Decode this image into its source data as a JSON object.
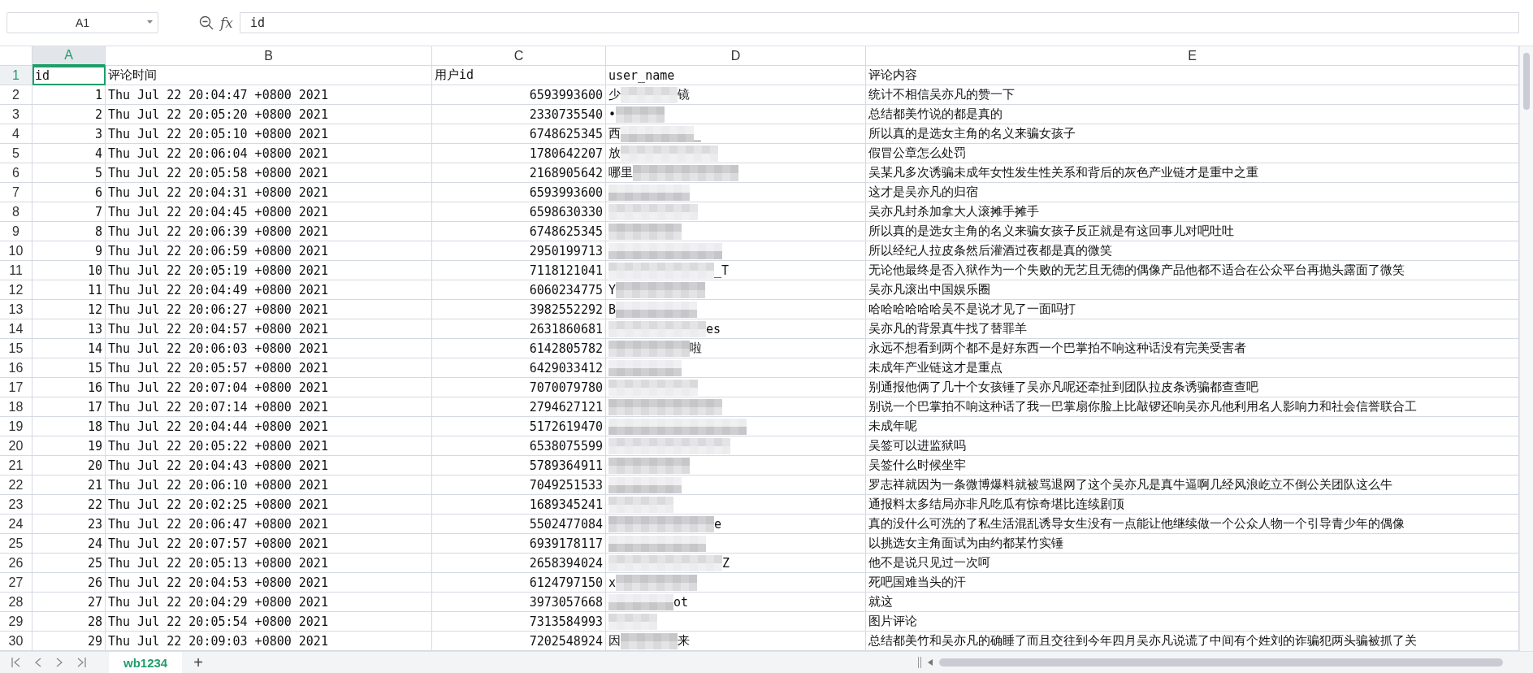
{
  "name_box": "A1",
  "formula_bar": {
    "function_label": "fx",
    "value": "id"
  },
  "columns": [
    {
      "label": "A",
      "selected": true
    },
    {
      "label": "B",
      "selected": false
    },
    {
      "label": "C",
      "selected": false
    },
    {
      "label": "D",
      "selected": false
    },
    {
      "label": "E",
      "selected": false
    }
  ],
  "header_row": {
    "number": "1",
    "selected": true,
    "cells": [
      "id",
      "评论时间",
      "用户id",
      "user_name",
      "评论内容"
    ]
  },
  "rows": [
    {
      "number": "2",
      "selected": false,
      "id": "1",
      "time": "Thu Jul 22 20:04:47 +0800 2021",
      "user_id": "6593993600",
      "user_name": {
        "start": "少",
        "end": "镜"
      },
      "comment": "统计不相信吴亦凡的赞一下"
    },
    {
      "number": "3",
      "selected": false,
      "id": "2",
      "time": "Thu Jul 22 20:05:20 +0800 2021",
      "user_id": "2330735540",
      "user_name": {
        "start": "•"
      },
      "comment": "总结都美竹说的都是真的"
    },
    {
      "number": "4",
      "selected": false,
      "id": "3",
      "time": "Thu Jul 22 20:05:10 +0800 2021",
      "user_id": "6748625345",
      "user_name": {
        "start": "西",
        "end": "_"
      },
      "comment": "所以真的是选女主角的名义来骗女孩子"
    },
    {
      "number": "5",
      "selected": false,
      "id": "4",
      "time": "Thu Jul 22 20:06:04 +0800 2021",
      "user_id": "1780642207",
      "user_name": {
        "start": "放"
      },
      "comment": "假冒公章怎么处罚"
    },
    {
      "number": "6",
      "selected": false,
      "id": "5",
      "time": "Thu Jul 22 20:05:58 +0800 2021",
      "user_id": "2168905642",
      "user_name": {
        "start": "哪里"
      },
      "comment": "吴某凡多次诱骗未成年女性发生性关系和背后的灰色产业链才是重中之重"
    },
    {
      "number": "7",
      "selected": false,
      "id": "6",
      "time": "Thu Jul 22 20:04:31 +0800 2021",
      "user_id": "6593993600",
      "user_name": {},
      "comment": "这才是吴亦凡的归宿"
    },
    {
      "number": "8",
      "selected": false,
      "id": "7",
      "time": "Thu Jul 22 20:04:45 +0800 2021",
      "user_id": "6598630330",
      "user_name": {},
      "comment": "吴亦凡封杀加拿大人滚摊手摊手"
    },
    {
      "number": "9",
      "selected": false,
      "id": "8",
      "time": "Thu Jul 22 20:06:39 +0800 2021",
      "user_id": "6748625345",
      "user_name": {},
      "comment": "所以真的是选女主角的名义来骗女孩子反正就是有这回事儿对吧吐吐"
    },
    {
      "number": "10",
      "selected": false,
      "id": "9",
      "time": "Thu Jul 22 20:06:59 +0800 2021",
      "user_id": "2950199713",
      "user_name": {},
      "comment": "所以经纪人拉皮条然后灌酒过夜都是真的微笑"
    },
    {
      "number": "11",
      "selected": false,
      "id": "10",
      "time": "Thu Jul 22 20:05:19 +0800 2021",
      "user_id": "7118121041",
      "user_name": {
        "end": "_T"
      },
      "comment": "无论他最终是否入狱作为一个失败的无艺且无德的偶像产品他都不适合在公众平台再抛头露面了微笑"
    },
    {
      "number": "12",
      "selected": false,
      "id": "11",
      "time": "Thu Jul 22 20:04:49 +0800 2021",
      "user_id": "6060234775",
      "user_name": {
        "start": "Y"
      },
      "comment": "吴亦凡滚出中国娱乐圈"
    },
    {
      "number": "13",
      "selected": false,
      "id": "12",
      "time": "Thu Jul 22 20:06:27 +0800 2021",
      "user_id": "3982552292",
      "user_name": {
        "start": "B"
      },
      "comment": "哈哈哈哈哈哈吴不是说才见了一面吗打"
    },
    {
      "number": "14",
      "selected": false,
      "id": "13",
      "time": "Thu Jul 22 20:04:57 +0800 2021",
      "user_id": "2631860681",
      "user_name": {
        "end": "es"
      },
      "comment": "吴亦凡的背景真牛找了替罪羊"
    },
    {
      "number": "15",
      "selected": false,
      "id": "14",
      "time": "Thu Jul 22 20:06:03 +0800 2021",
      "user_id": "6142805782",
      "user_name": {
        "end": "啦"
      },
      "comment": "永远不想看到两个都不是好东西一个巴掌拍不响这种话没有完美受害者"
    },
    {
      "number": "16",
      "selected": false,
      "id": "15",
      "time": "Thu Jul 22 20:05:57 +0800 2021",
      "user_id": "6429033412",
      "user_name": {},
      "comment": "未成年产业链这才是重点"
    },
    {
      "number": "17",
      "selected": false,
      "id": "16",
      "time": "Thu Jul 22 20:07:04 +0800 2021",
      "user_id": "7070079780",
      "user_name": {},
      "comment": "别通报他俩了几十个女孩锤了吴亦凡呢还牵扯到团队拉皮条诱骗都查查吧"
    },
    {
      "number": "18",
      "selected": false,
      "id": "17",
      "time": "Thu Jul 22 20:07:14 +0800 2021",
      "user_id": "2794627121",
      "user_name": {},
      "comment": "别说一个巴掌拍不响这种话了我一巴掌扇你脸上比敲锣还响吴亦凡他利用名人影响力和社会信誉联合工"
    },
    {
      "number": "19",
      "selected": false,
      "id": "18",
      "time": "Thu Jul 22 20:04:44 +0800 2021",
      "user_id": "5172619470",
      "user_name": {},
      "comment": "未成年呢"
    },
    {
      "number": "20",
      "selected": false,
      "id": "19",
      "time": "Thu Jul 22 20:05:22 +0800 2021",
      "user_id": "6538075599",
      "user_name": {},
      "comment": "吴签可以进监狱吗"
    },
    {
      "number": "21",
      "selected": false,
      "id": "20",
      "time": "Thu Jul 22 20:04:43 +0800 2021",
      "user_id": "5789364911",
      "user_name": {},
      "comment": "吴签什么时候坐牢"
    },
    {
      "number": "22",
      "selected": false,
      "id": "21",
      "time": "Thu Jul 22 20:06:10 +0800 2021",
      "user_id": "7049251533",
      "user_name": {},
      "comment": "罗志祥就因为一条微博爆料就被骂退网了这个吴亦凡是真牛逼啊几经风浪屹立不倒公关团队这么牛"
    },
    {
      "number": "23",
      "selected": false,
      "id": "22",
      "time": "Thu Jul 22 20:02:25 +0800 2021",
      "user_id": "1689345241",
      "user_name": {},
      "comment": "通报料太多结局亦非凡吃瓜有惊奇堪比连续剧顶"
    },
    {
      "number": "24",
      "selected": false,
      "id": "23",
      "time": "Thu Jul 22 20:06:47 +0800 2021",
      "user_id": "5502477084",
      "user_name": {
        "end": "e"
      },
      "comment": "真的没什么可洗的了私生活混乱诱导女生没有一点能让他继续做一个公众人物一个引导青少年的偶像"
    },
    {
      "number": "25",
      "selected": false,
      "id": "24",
      "time": "Thu Jul 22 20:07:57 +0800 2021",
      "user_id": "6939178117",
      "user_name": {},
      "comment": "以挑选女主角面试为由约都某竹实锤"
    },
    {
      "number": "26",
      "selected": false,
      "id": "25",
      "time": "Thu Jul 22 20:05:13 +0800 2021",
      "user_id": "2658394024",
      "user_name": {
        "end": "Z"
      },
      "comment": "他不是说只见过一次呵"
    },
    {
      "number": "27",
      "selected": false,
      "id": "26",
      "time": "Thu Jul 22 20:04:53 +0800 2021",
      "user_id": "6124797150",
      "user_name": {
        "start": "x"
      },
      "comment": "死吧国难当头的汗"
    },
    {
      "number": "28",
      "selected": false,
      "id": "27",
      "time": "Thu Jul 22 20:04:29 +0800 2021",
      "user_id": "3973057668",
      "user_name": {
        "end": "ot"
      },
      "comment": "就这"
    },
    {
      "number": "29",
      "selected": false,
      "id": "28",
      "time": "Thu Jul 22 20:05:54 +0800 2021",
      "user_id": "7313584993",
      "user_name": {},
      "comment": "图片评论"
    },
    {
      "number": "30",
      "selected": false,
      "id": "29",
      "time": "Thu Jul 22 20:09:03 +0800 2021",
      "user_id": "7202548924",
      "user_name": {
        "start": "因",
        "end": "来"
      },
      "comment": "总结都美竹和吴亦凡的确睡了而且交往到今年四月吴亦凡说谎了中间有个姓刘的诈骗犯两头骗被抓了关"
    }
  ],
  "sheet_tabs": [
    {
      "label": "wb1234",
      "selected": true
    }
  ],
  "add_sheet": "+"
}
